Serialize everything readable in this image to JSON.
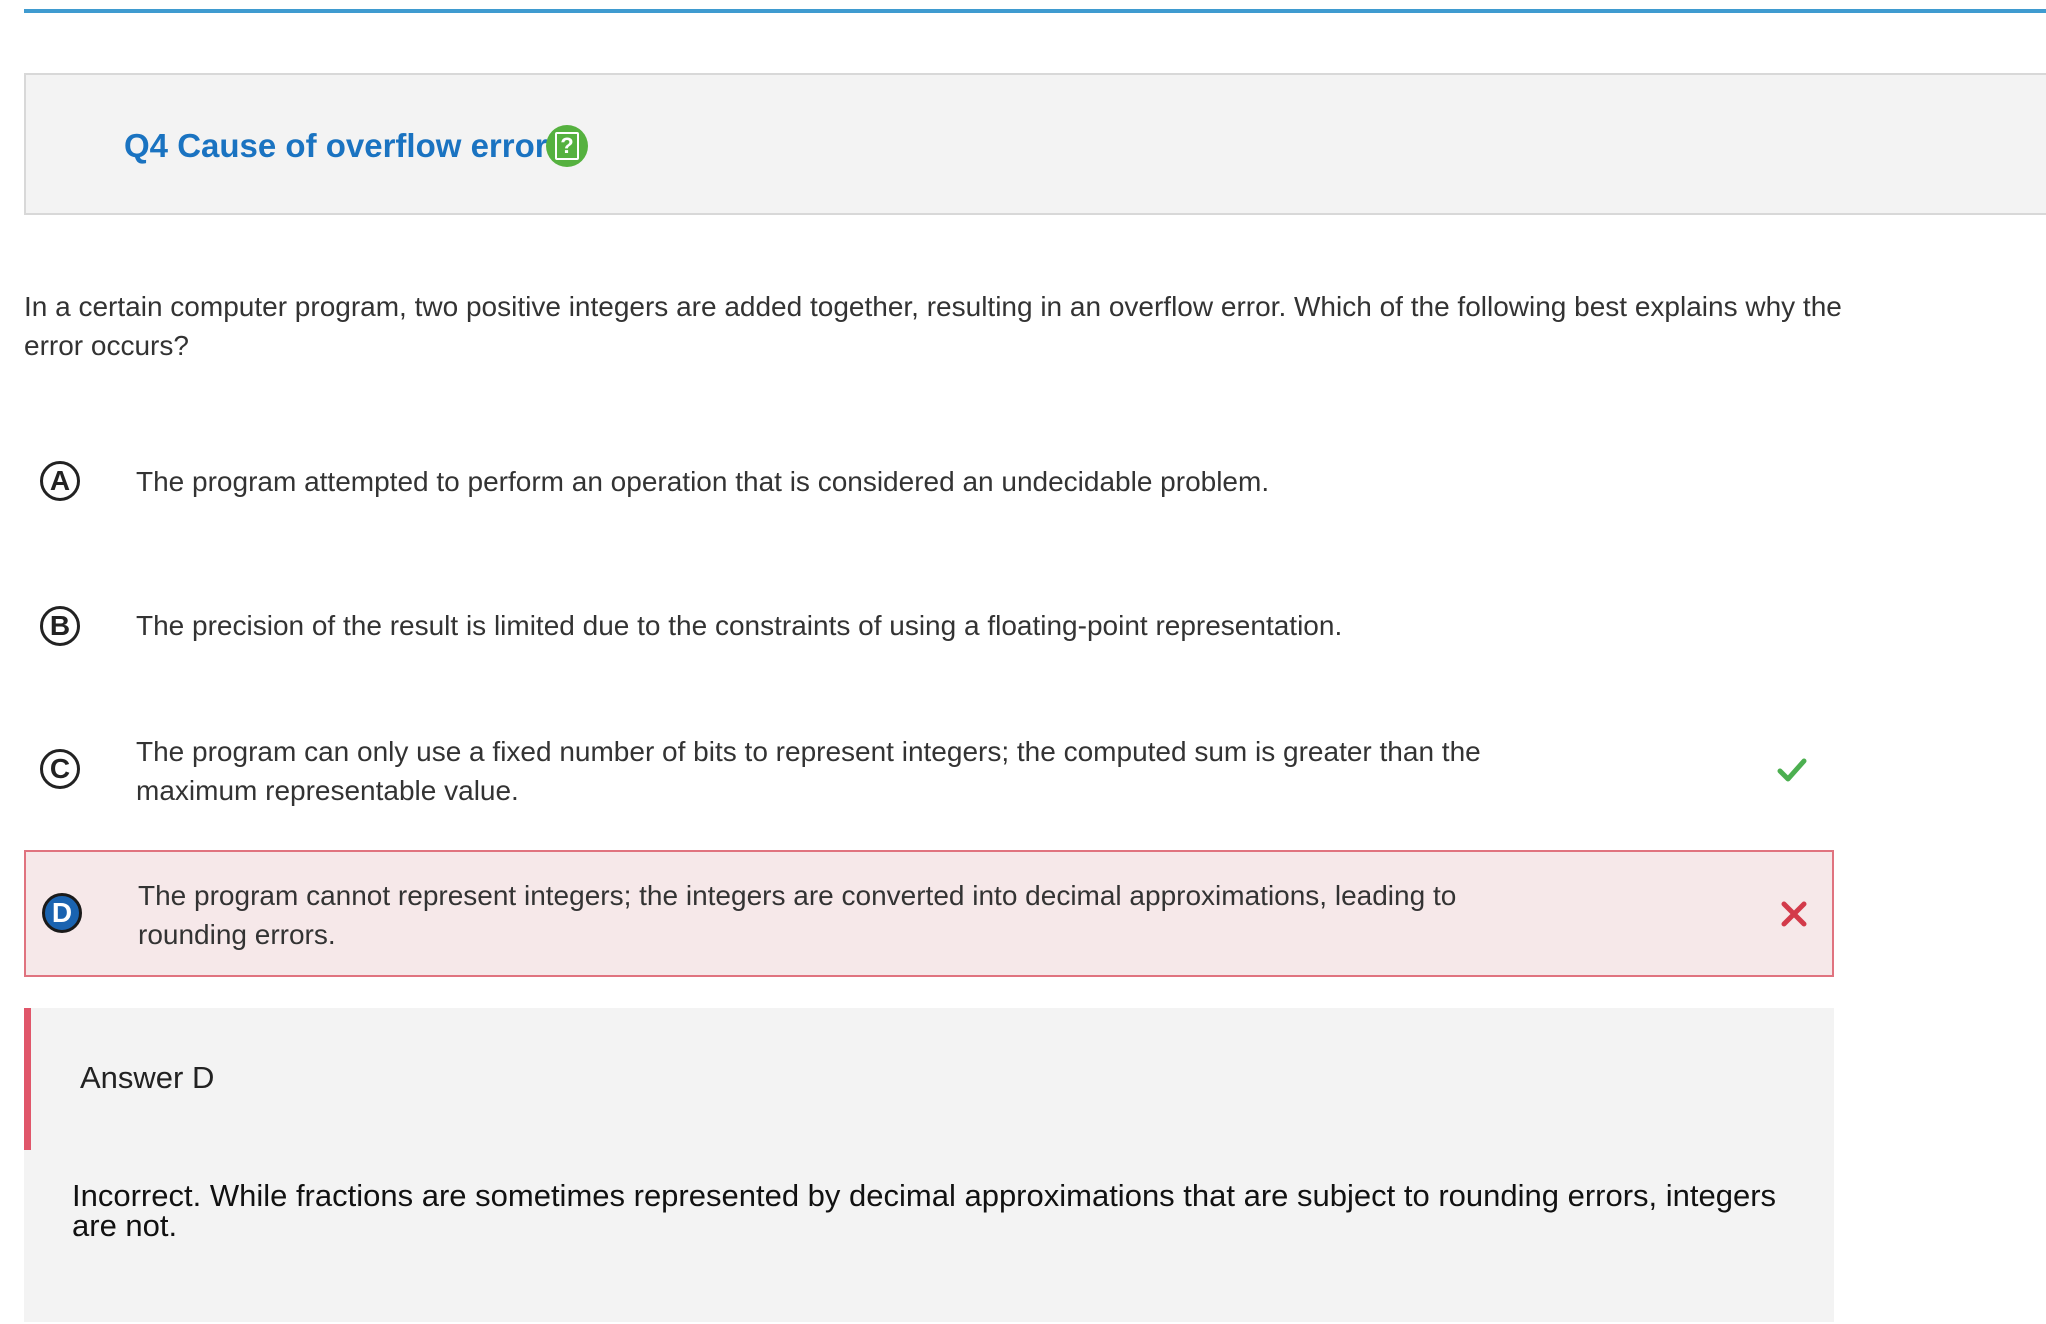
{
  "header": {
    "title": "Q4 Cause of overflow error",
    "help_icon": "question-clipboard-icon"
  },
  "question": {
    "text": "In a certain computer program, two positive integers are added together, resulting in an overflow error. Which of the following best explains why the error occurs?"
  },
  "choices": [
    {
      "letter": "A",
      "text": "The program attempted to perform an operation that is considered an undecidable problem.",
      "status": "none"
    },
    {
      "letter": "B",
      "text": "The precision of the result is limited due to the constraints of using a floating-point representation.",
      "status": "none"
    },
    {
      "letter": "C",
      "text": "The program can only use a fixed number of bits to represent integers; the computed sum is greater than the maximum representable value.",
      "status": "correct",
      "mark_icon": "checkmark-icon"
    },
    {
      "letter": "D",
      "text": "The program cannot represent integers; the integers are converted into decimal approximations, leading to rounding errors.",
      "status": "selected-incorrect",
      "mark_icon": "x-mark-icon"
    }
  ],
  "feedback": {
    "answer_label": "Answer D",
    "explanation": "Incorrect. While fractions are sometimes represented by decimal approximations that are subject to rounding errors, integers are not."
  },
  "colors": {
    "accent_blue": "#1a73c1",
    "top_rule": "#3f9bd0",
    "correct_green": "#4caf50",
    "incorrect_red": "#d33a4a",
    "wrong_bg": "#f6e8e9"
  }
}
